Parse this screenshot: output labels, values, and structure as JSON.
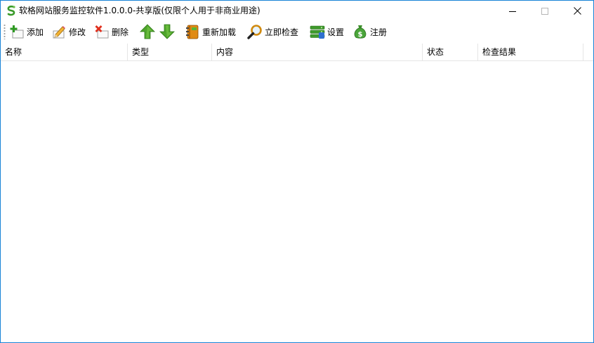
{
  "window": {
    "title": "软格网站服务监控软件1.0.0.0-共享版(仅限个人用于非商业用途)",
    "accent_color": "#1883d7",
    "app_icon": "leaf-s-icon",
    "controls": {
      "minimize_icon": "minimize-icon",
      "maximize_icon": "maximize-icon",
      "close_icon": "close-icon"
    }
  },
  "toolbar": {
    "add_label": "添加",
    "edit_label": "修改",
    "delete_label": "删除",
    "move_up_icon": "arrow-up-icon",
    "move_down_icon": "arrow-down-icon",
    "reload_label": "重新加载",
    "check_now_label": "立即检查",
    "settings_label": "设置",
    "register_label": "注册"
  },
  "table": {
    "columns": [
      "名称",
      "类型",
      "内容",
      "状态",
      "检查结果"
    ],
    "rows": []
  }
}
